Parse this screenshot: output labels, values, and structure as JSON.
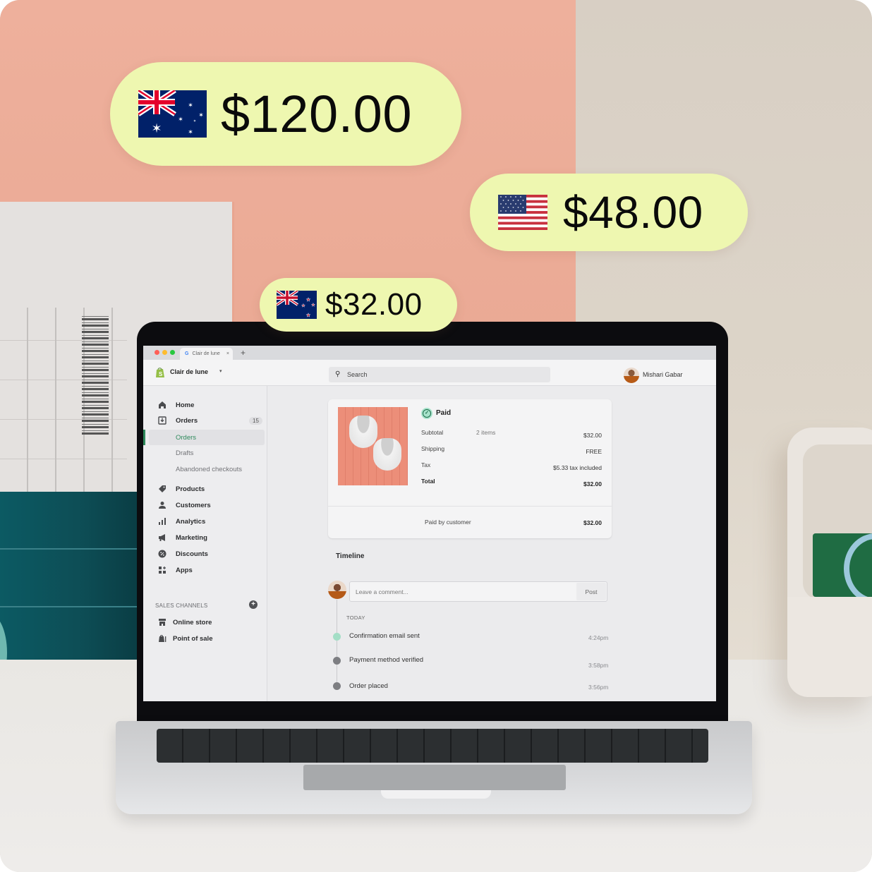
{
  "price_tags": [
    {
      "country": "Australia",
      "flag": "australia-flag-icon",
      "amount": "$120.00"
    },
    {
      "country": "United States",
      "flag": "us-flag-icon",
      "amount": "$48.00"
    },
    {
      "country": "New Zealand",
      "flag": "new-zealand-flag-icon",
      "amount": "$32.00"
    }
  ],
  "browser": {
    "tab_title": "Clair de lune",
    "tab_close": "×",
    "new_tab": "+"
  },
  "topbar": {
    "store_name": "Clair de lune",
    "store_caret": "▾",
    "search_placeholder": "Search",
    "user_name": "Mishari Gabar"
  },
  "sidebar": {
    "items": [
      {
        "label": "Home",
        "icon": "home-icon"
      },
      {
        "label": "Orders",
        "icon": "orders-icon",
        "badge": "15"
      },
      {
        "label": "Orders",
        "sub": true,
        "active": true
      },
      {
        "label": "Drafts",
        "sub": true
      },
      {
        "label": "Abandoned checkouts",
        "sub": true
      },
      {
        "label": "Products",
        "icon": "tag-icon"
      },
      {
        "label": "Customers",
        "icon": "person-icon"
      },
      {
        "label": "Analytics",
        "icon": "bar-chart-icon"
      },
      {
        "label": "Marketing",
        "icon": "megaphone-icon"
      },
      {
        "label": "Discounts",
        "icon": "discount-icon"
      },
      {
        "label": "Apps",
        "icon": "apps-icon"
      }
    ],
    "sales_channels_title": "SALES CHANNELS",
    "channels": [
      {
        "label": "Online store",
        "icon": "store-icon"
      },
      {
        "label": "Point of sale",
        "icon": "shopping-bag-icon"
      }
    ]
  },
  "order": {
    "status": "Paid",
    "rows": [
      {
        "label": "Subtotal",
        "detail": "2 items",
        "value": "$32.00"
      },
      {
        "label": "Shipping",
        "detail": "",
        "value": "FREE"
      },
      {
        "label": "Tax",
        "detail": "",
        "value": "$5.33 tax included"
      },
      {
        "label": "Total",
        "detail": "",
        "value": "$32.00"
      }
    ],
    "paid_by_label": "Paid by customer",
    "paid_by_value": "$32.00"
  },
  "timeline": {
    "title": "Timeline",
    "comment_placeholder": "Leave a comment...",
    "post_label": "Post",
    "group_label": "TODAY",
    "events": [
      {
        "label": "Confirmation email sent",
        "time": "4:24pm",
        "status": "latest"
      },
      {
        "label": "Payment method verified",
        "time": "3:58pm",
        "status": "past"
      },
      {
        "label": "Order placed",
        "time": "3:56pm",
        "status": "past"
      }
    ]
  },
  "colors": {
    "pill_bg": "#eef7b0",
    "accent_green": "#2f8a5c",
    "wall_pink": "#eeb09c",
    "wall_beige": "#d8cfc4"
  }
}
